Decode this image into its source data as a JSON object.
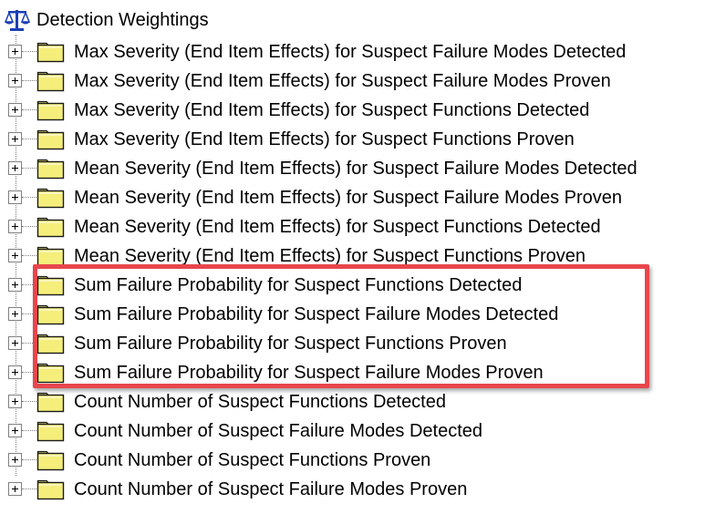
{
  "tree": {
    "root": {
      "label": "Detection Weightings",
      "icon": "scales-icon"
    },
    "items": [
      {
        "label": "Max Severity (End Item Effects) for Suspect Failure Modes Detected",
        "icon": "folder-icon",
        "expanded": false
      },
      {
        "label": "Max Severity (End Item Effects) for Suspect Failure Modes Proven",
        "icon": "folder-icon",
        "expanded": false
      },
      {
        "label": "Max Severity (End Item Effects) for Suspect Functions Detected",
        "icon": "folder-icon",
        "expanded": false
      },
      {
        "label": "Max Severity (End Item Effects) for Suspect Functions Proven",
        "icon": "folder-icon",
        "expanded": false
      },
      {
        "label": "Mean Severity (End Item Effects) for Suspect Failure Modes Detected",
        "icon": "folder-icon",
        "expanded": false
      },
      {
        "label": "Mean Severity (End Item Effects) for Suspect Failure Modes Proven",
        "icon": "folder-icon",
        "expanded": false
      },
      {
        "label": "Mean Severity (End Item Effects) for Suspect Functions Detected",
        "icon": "folder-icon",
        "expanded": false
      },
      {
        "label": "Mean Severity (End Item Effects) for Suspect Functions Proven",
        "icon": "folder-icon",
        "expanded": false
      },
      {
        "label": "Sum Failure Probability for Suspect Functions Detected",
        "icon": "folder-icon",
        "expanded": false,
        "highlighted": true
      },
      {
        "label": "Sum Failure Probability for Suspect Failure Modes Detected",
        "icon": "folder-icon",
        "expanded": false,
        "highlighted": true
      },
      {
        "label": "Sum Failure Probability for Suspect Functions Proven",
        "icon": "folder-icon",
        "expanded": false,
        "highlighted": true
      },
      {
        "label": "Sum Failure Probability for Suspect Failure Modes Proven",
        "icon": "folder-icon",
        "expanded": false,
        "highlighted": true
      },
      {
        "label": "Count Number of Suspect Functions Detected",
        "icon": "folder-icon",
        "expanded": false
      },
      {
        "label": "Count Number of Suspect Failure Modes Detected",
        "icon": "folder-icon",
        "expanded": false
      },
      {
        "label": "Count Number of Suspect Functions Proven",
        "icon": "folder-icon",
        "expanded": false
      },
      {
        "label": "Count Number of Suspect Failure Modes Proven",
        "icon": "folder-icon",
        "expanded": false
      }
    ]
  },
  "colors": {
    "highlight_border": "#e8464c",
    "folder_fill": "#f5ee7a",
    "folder_outline": "#1a1a1a",
    "scales_icon": "#1a3fb5",
    "connector": "#808080"
  }
}
